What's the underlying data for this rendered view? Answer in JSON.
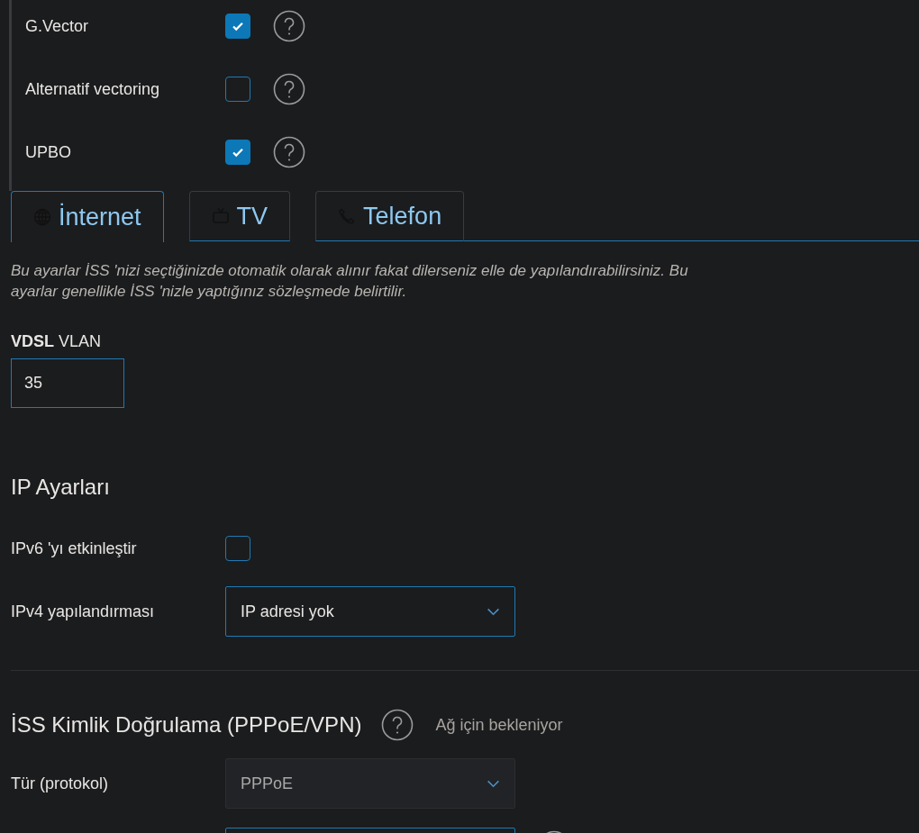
{
  "dsl_options": [
    {
      "label": "G.Vector",
      "checked": true
    },
    {
      "label": "Alternatif vectoring",
      "checked": false
    },
    {
      "label": "UPBO",
      "checked": true
    }
  ],
  "tabs": [
    {
      "label": "İnternet",
      "selected": true
    },
    {
      "label": "TV",
      "selected": false
    },
    {
      "label": "Telefon",
      "selected": false
    }
  ],
  "description": "Bu ayarlar İSS 'nizi seçtiğinizde otomatik olarak alınır fakat dilerseniz elle de yapılandırabilirsiniz. Bu ayarlar genellikle İSS 'nizle yaptığınız sözleşmede belirtilir.",
  "vlan": {
    "label": "**VDSL** VLAN",
    "value": "35"
  },
  "ip_settings": {
    "title": "IP Ayarları",
    "rows": [
      {
        "kind": "checkbox",
        "label": "IPv6 'yı etkinleştir",
        "checked": false
      },
      {
        "kind": "select",
        "label": "IPv4 yapılandırması",
        "value": "IP adresi yok",
        "disabled": false
      }
    ]
  },
  "isp_auth": {
    "title": "İSS Kimlik Doğrulama (PPPoE/VPN)",
    "status": "Ağ için bekleniyor",
    "rows": [
      {
        "kind": "select",
        "label": "Tür (protokol)",
        "value": "PPPoE",
        "disabled": true
      },
      {
        "kind": "input"
      }
    ]
  }
}
